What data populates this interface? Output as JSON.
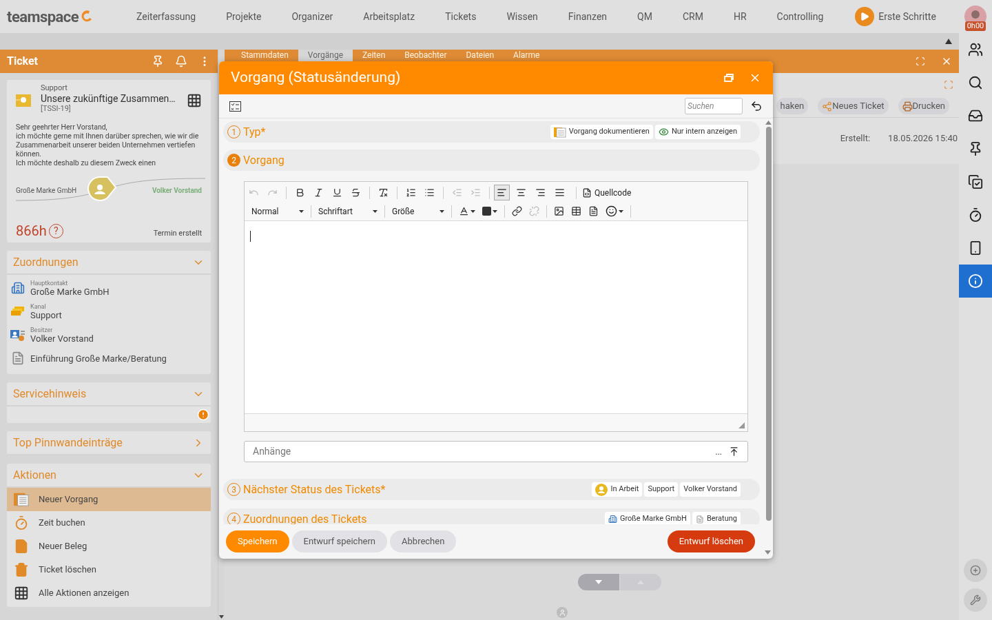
{
  "topbar": {
    "logo": "teamspace",
    "nav": [
      {
        "label": "Zeiterfassung"
      },
      {
        "label": "Projekte"
      },
      {
        "label": "Organizer"
      },
      {
        "label": "Arbeitsplatz"
      },
      {
        "label": "Tickets"
      },
      {
        "label": "Wissen"
      },
      {
        "label": "Finanzen"
      },
      {
        "label": "QM"
      },
      {
        "label": "CRM"
      },
      {
        "label": "HR"
      },
      {
        "label": "Controlling"
      }
    ],
    "help": "Erste Schritte",
    "timer": "0h00"
  },
  "ticket_panel": {
    "title": "Ticket",
    "card": {
      "channel": "Support",
      "title": "Unsere zukünftige Zusammen…",
      "id": "[TSSI-19]",
      "body": [
        "Sehr geehrter Herr Vorstand,",
        "ich möchte gerne mit Ihnen darüber sprechen, wie wir die Zusammenarbeit unserer beiden Unternehmen vertiefen können.",
        "Ich möchte deshalb zu diesem Zweck einen"
      ],
      "sender": "Große Marke GmbH",
      "recipient": "Volker Vorstand",
      "hours": "866h",
      "hours_hint": "?",
      "status": "Termin erstellt"
    },
    "assignments": {
      "title": "Zuordnungen",
      "expanded": true,
      "items": [
        {
          "kind": "contact",
          "caption": "Hauptkontakt",
          "value": "Große Marke GmbH"
        },
        {
          "kind": "channel",
          "caption": "Kanal",
          "value": "Support"
        },
        {
          "kind": "owner",
          "caption": "Besitzer",
          "value": "Volker Vorstand"
        },
        {
          "kind": "project",
          "value": "Einführung Große Marke/Beratung"
        }
      ]
    },
    "service_note": {
      "title": "Servicehinweis",
      "expanded": true
    },
    "pinboard": {
      "title": "Top Pinnwandeinträge",
      "expanded": false
    },
    "actions": {
      "title": "Aktionen",
      "expanded": true,
      "items": [
        {
          "kind": "process",
          "label": "Neuer Vorgang",
          "selected": true
        },
        {
          "kind": "time",
          "label": "Zeit buchen",
          "selected": false
        },
        {
          "kind": "receipt",
          "label": "Neuer Beleg",
          "selected": false
        },
        {
          "kind": "delete",
          "label": "Ticket löschen",
          "selected": false
        },
        {
          "kind": "all",
          "label": "Alle Aktionen anzeigen",
          "selected": false
        }
      ]
    }
  },
  "ticket_tabs": [
    {
      "label": "Stammdaten",
      "selected": false
    },
    {
      "label": "Vorgänge",
      "selected": true
    },
    {
      "label": "Zeiten",
      "selected": false
    },
    {
      "label": "Beobachter",
      "selected": false
    },
    {
      "label": "Dateien",
      "selected": false
    },
    {
      "label": "Alarme",
      "selected": false
    }
  ],
  "ticket_toolbar": [
    {
      "kind": "check",
      "label": "haken"
    },
    {
      "kind": "new",
      "label": "Neues Ticket"
    },
    {
      "kind": "print",
      "label": "Drucken"
    }
  ],
  "created": {
    "label": "Erstellt:",
    "value": "18.05.2026 15:40"
  },
  "dialog": {
    "title": "Vorgang (Statusänderung)",
    "search_placeholder": "Suchen",
    "sections": [
      {
        "number": "1",
        "title": "Typ*",
        "selected": false,
        "chips": [
          {
            "kind": "document",
            "label": "Vorgang dokumentieren"
          },
          {
            "kind": "eye",
            "label": "Nur intern anzeigen"
          }
        ]
      },
      {
        "number": "2",
        "title": "Vorgang",
        "selected": true
      },
      {
        "number": "3",
        "title": "Nächster Status des Tickets*",
        "selected": false,
        "chips": [
          {
            "kind": "status",
            "label": "In Arbeit"
          },
          {
            "kind": "plain",
            "label": "Support"
          },
          {
            "kind": "plain",
            "label": "Volker Vorstand"
          }
        ]
      },
      {
        "number": "4",
        "title": "Zuordnungen des Tickets",
        "selected": false,
        "chips": [
          {
            "kind": "company",
            "label": "Große Marke GmbH"
          },
          {
            "kind": "project",
            "label": "Beratung"
          }
        ]
      }
    ],
    "editor": {
      "format": "Normal",
      "font": "Schriftart",
      "size": "Größe",
      "source": "Quellcode",
      "align": [
        {
          "kind": "left",
          "selected": true
        },
        {
          "kind": "center",
          "selected": false
        },
        {
          "kind": "right",
          "selected": false
        },
        {
          "kind": "justify",
          "selected": false
        }
      ]
    },
    "attachments": {
      "placeholder": "Anhänge",
      "browse": "..."
    },
    "buttons": [
      {
        "kind": "primary",
        "label": "Speichern"
      },
      {
        "kind": "secondary",
        "label": "Entwurf speichern"
      },
      {
        "kind": "secondary",
        "label": "Abbrechen"
      },
      {
        "kind": "danger",
        "label": "Entwurf löschen"
      }
    ]
  },
  "sidebar": [
    {
      "kind": "people",
      "selected": false
    },
    {
      "kind": "search",
      "selected": false
    },
    {
      "kind": "inbox",
      "selected": false
    },
    {
      "kind": "pin",
      "selected": false
    },
    {
      "kind": "tasks",
      "selected": false
    },
    {
      "kind": "timer",
      "selected": false
    },
    {
      "kind": "phone",
      "selected": false
    },
    {
      "kind": "info",
      "selected": true
    }
  ]
}
